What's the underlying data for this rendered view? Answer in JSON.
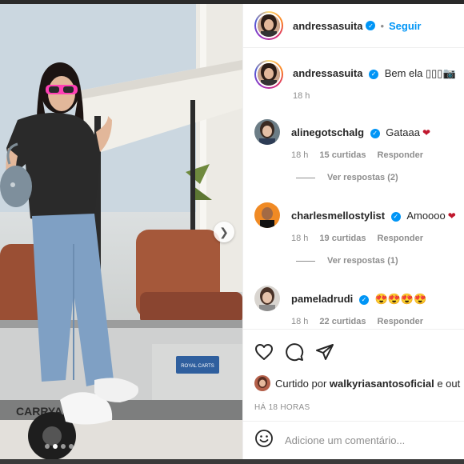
{
  "post": {
    "author": "andressasuita",
    "follow_label": "Seguir",
    "separator": "•"
  },
  "caption": {
    "username": "andressasuita",
    "text": "Bem ela ▯▯▯📷",
    "time": "18 h"
  },
  "comments": [
    {
      "username": "alinegotschalg",
      "text": "Gataaa",
      "emoji": "❤",
      "time": "18 h",
      "likes": "15 curtidas",
      "reply_label": "Responder",
      "view_replies": "Ver respostas (2)"
    },
    {
      "username": "charlesmellostylist",
      "text": "Amoooo",
      "emoji": "❤",
      "time": "18 h",
      "likes": "19 curtidas",
      "reply_label": "Responder",
      "view_replies": "Ver respostas (1)"
    },
    {
      "username": "pameladrudi",
      "text": "😍😍😍😍",
      "emoji": "",
      "time": "18 h",
      "likes": "22 curtidas",
      "reply_label": "Responder"
    }
  ],
  "likes": {
    "prefix": "Curtido por ",
    "user": "walkyriasantosoficial",
    "suffix": " e out"
  },
  "time_ago": "HÁ 18 HORAS",
  "add_comment": {
    "placeholder": "Adicione um comentário..."
  },
  "carousel": {
    "slide_count": 4,
    "active_index": 1,
    "cart_badge": "ROYAL CARTS",
    "cart_brand": "CARRYAL"
  },
  "colors": {
    "accent": "#0095f6",
    "heart": "#c0172d",
    "text": "#262626",
    "muted": "#8e8e8e"
  }
}
